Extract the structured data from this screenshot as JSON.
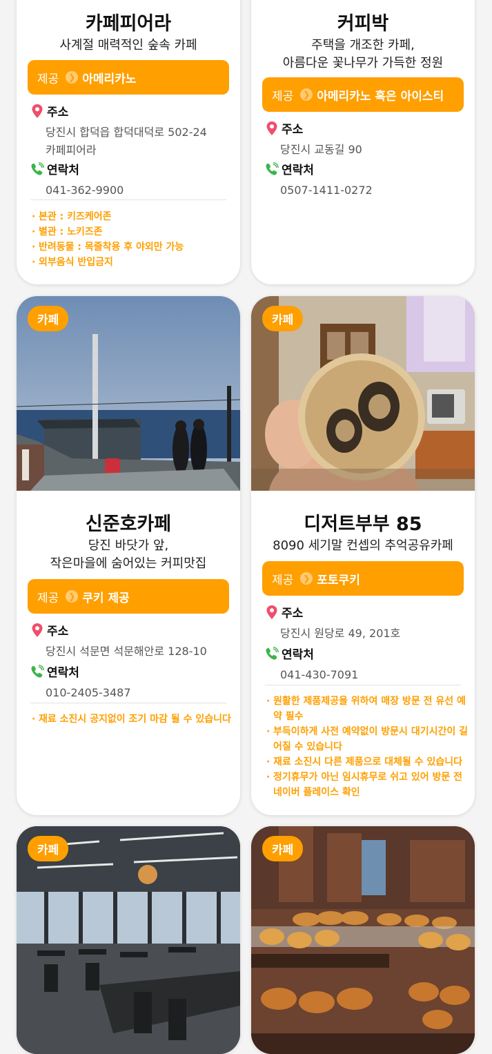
{
  "offer_label": "제공",
  "address_label": "주소",
  "contact_label": "연락처",
  "badge_label": "카페",
  "cards": [
    {
      "title": "카페피어라",
      "desc": [
        "사계절 매력적인 숲속 카페"
      ],
      "offer": "아메리카노",
      "address": [
        "당진시 합덕읍 합덕대덕로 502-24",
        "카페피어라"
      ],
      "phone": "041-362-9900",
      "notes": [
        "본관 : 키즈케어존",
        "별관 : 노키즈존",
        "반려동물 : 목줄착용 후 야외만 가능",
        "외부음식 반입금지"
      ]
    },
    {
      "title": "커피박",
      "desc": [
        "주택을 개조한 카페,",
        "아름다운 꽃나무가 가득한 정원"
      ],
      "offer": "아메리카노 혹은 아이스티",
      "address": [
        "당진시 교동길 90"
      ],
      "phone": "0507-1411-0272",
      "notes": []
    },
    {
      "title": "신준호카페",
      "desc": [
        "당진 바닷가 앞,",
        "작은마을에 숨어있는 커피맛집"
      ],
      "offer": "쿠키 제공",
      "address": [
        "당진시 석문면 석문해안로 128-10"
      ],
      "phone": "010-2405-3487",
      "notes": [
        "재료 소진시 공지없이 조기 마감 될 수 있습니다"
      ]
    },
    {
      "title": "디저트부부 85",
      "desc": [
        "8090 세기말 컨셉의 추억공유카페"
      ],
      "offer": "포토쿠키",
      "address": [
        "당진시 원당로 49, 201호"
      ],
      "phone": "041-430-7091",
      "notes": [
        "원활한 제품제공을 위하여 매장 방문 전 유선 예약 필수",
        "부득이하게 사전 예약없이 방문시 대기시간이 길어질 수 있습니다",
        "재료 소진시 다른 제품으로 대체될 수 있습니다",
        "정기휴무가 아닌 임시휴무로 쉬고 있어 방문 전 네이버 플레이스 확인"
      ]
    }
  ]
}
